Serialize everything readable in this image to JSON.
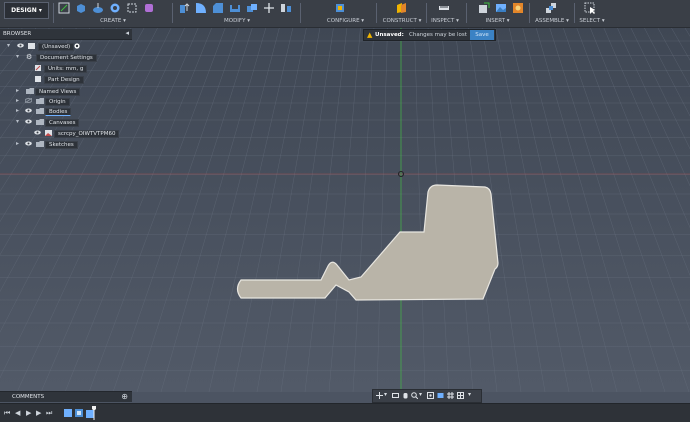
{
  "toolbar": {
    "workspace": "DESIGN",
    "groups": {
      "create": "CREATE",
      "modify": "MODIFY",
      "configure": "CONFIGURE",
      "construct": "CONSTRUCT",
      "inspect": "INSPECT",
      "insert": "INSERT",
      "assemble": "ASSEMBLE",
      "select": "SELECT"
    }
  },
  "warning": {
    "title": "Unsaved:",
    "message": "Changes may be lost",
    "button": "Save"
  },
  "browser": {
    "title": "BROWSER",
    "root": "(Unsaved)",
    "items": [
      {
        "label": "Document Settings"
      },
      {
        "label": "Units: mm, g"
      },
      {
        "label": "Part Design"
      },
      {
        "label": "Named Views"
      },
      {
        "label": "Origin"
      },
      {
        "label": "Bodies"
      },
      {
        "label": "Canvases"
      },
      {
        "label": "scrcpy_OIWTVTPM60"
      },
      {
        "label": "Sketches"
      }
    ]
  },
  "comments": {
    "title": "COMMENTS"
  },
  "colors": {
    "viewport_bg": "#4c5462",
    "grid": "#5d6574",
    "toolbar_bg": "#3a3f47",
    "part_fill": "#b9b4a8",
    "axis_green": "#3fbf3f",
    "axis_red": "#c24a4a",
    "accent_blue": "#3b82c4"
  }
}
